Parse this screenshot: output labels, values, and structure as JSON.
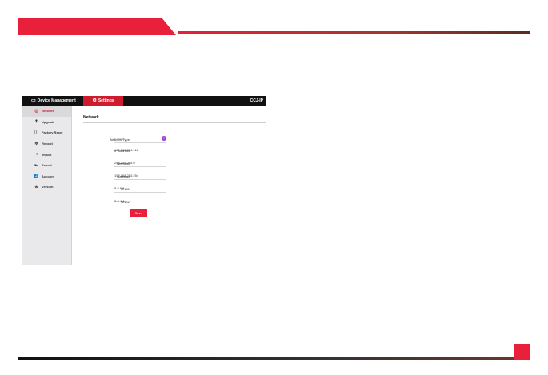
{
  "app": {
    "header": {
      "device_management": "Device Management",
      "settings": "Settings",
      "model": "CCJ-IP"
    },
    "sidebar": {
      "items": [
        {
          "label": "Network",
          "icon": "network-icon",
          "active": true
        },
        {
          "label": "Upgrade",
          "icon": "upgrade-icon",
          "active": false
        },
        {
          "label": "Factory Reset",
          "icon": "factory-reset-icon",
          "active": false
        },
        {
          "label": "Reboot",
          "icon": "reboot-icon",
          "active": false
        },
        {
          "label": "Import",
          "icon": "import-icon",
          "active": false
        },
        {
          "label": "Export",
          "icon": "export-icon",
          "active": false
        },
        {
          "label": "Account",
          "icon": "account-icon",
          "active": false
        },
        {
          "label": "Version",
          "icon": "version-icon",
          "active": false
        }
      ]
    },
    "content": {
      "title": "Network",
      "fields": [
        {
          "label": "Network Type",
          "value": "STATIC"
        },
        {
          "label": "IP Address",
          "value": "192.168.254.116"
        },
        {
          "label": "Netmask",
          "value": "255.255.255.0"
        },
        {
          "label": "Gateway",
          "value": "192.168.254.254"
        },
        {
          "label": "DNS1",
          "value": "8.8.8.8"
        },
        {
          "label": "DNS2",
          "value": "8.8.4.4"
        }
      ],
      "help": "?",
      "save_label": "Save"
    }
  },
  "colors": {
    "accent": "#e8203a",
    "header": "#111111",
    "sidebar": "#e9e9eb"
  }
}
